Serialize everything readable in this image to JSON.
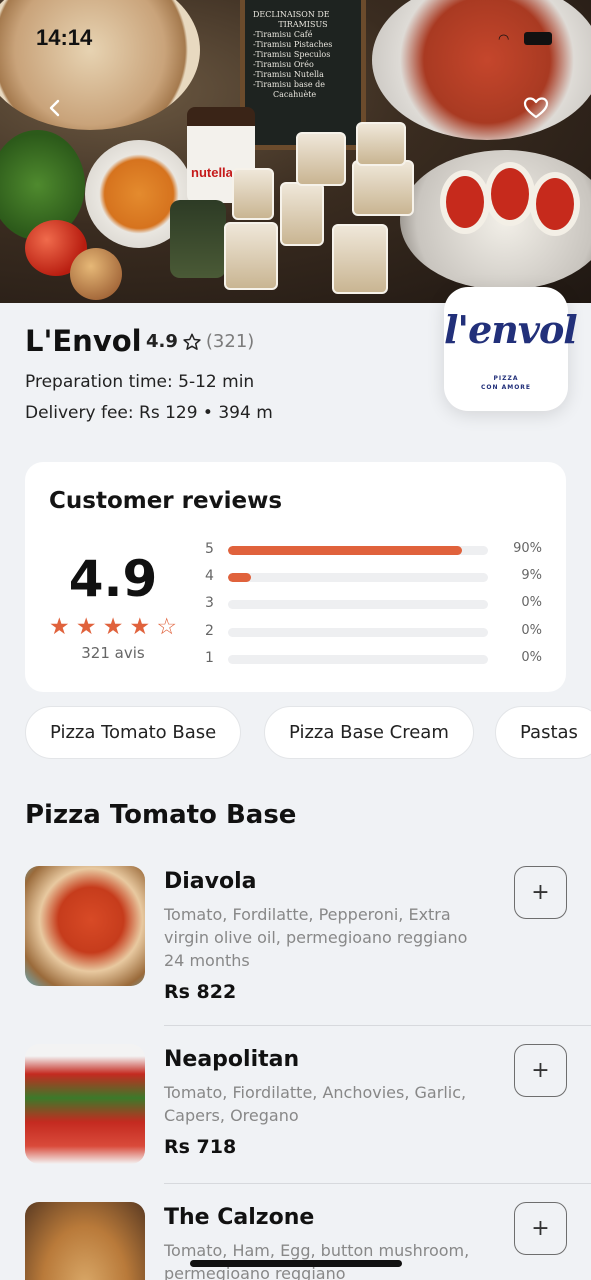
{
  "status_bar": {
    "time": "14:14"
  },
  "hero": {
    "chalkboard_lines": [
      "DECLINAISON DE",
      "TIRAMISUS",
      "-Tiramisu Café",
      "-Tiramisu Pistaches",
      "-Tiramisu Speculos",
      "-Tiramisu Oréo",
      "-Tiramisu Nutella",
      "-Tiramisu base de",
      "Cacahuète"
    ],
    "jar_label": "nutella"
  },
  "restaurant": {
    "name": "L'Envol",
    "rating": "4.9",
    "rating_count": "(321)",
    "prep_time": "Preparation time: 5-12 min",
    "delivery": "Delivery fee: Rs 129 • 394 m",
    "logo": {
      "word": "l'envol",
      "line1": "PIZZA",
      "line2": "CON AMORE"
    }
  },
  "reviews": {
    "title": "Customer reviews",
    "score": "4.9",
    "stars": [
      1,
      1,
      1,
      1,
      0
    ],
    "count_label": "321 avis",
    "distribution": [
      {
        "stars": "5",
        "fraction": 0.9,
        "label": "90%"
      },
      {
        "stars": "4",
        "fraction": 0.09,
        "label": "9%"
      },
      {
        "stars": "3",
        "fraction": 0,
        "label": "0%"
      },
      {
        "stars": "2",
        "fraction": 0,
        "label": "0%"
      },
      {
        "stars": "1",
        "fraction": 0,
        "label": "0%"
      }
    ]
  },
  "categories": [
    "Pizza Tomato Base",
    "Pizza Base Cream",
    "Pastas"
  ],
  "section_title": "Pizza Tomato Base",
  "items": [
    {
      "name": "Diavola",
      "description": "Tomato, Fordilatte, Pepperoni, Extra virgin olive oil, permegioano reggiano 24 months",
      "price": "Rs 822",
      "add_label": "+"
    },
    {
      "name": "Neapolitan",
      "description": "Tomato, Fiordilatte, Anchovies, Garlic, Capers, Oregano",
      "price": "Rs 718",
      "add_label": "+"
    },
    {
      "name": "The Calzone",
      "description": "Tomato, Ham, Egg, button mushroom, permegioano reggiano",
      "price": "",
      "add_label": "+"
    }
  ],
  "colors": {
    "accent": "#e0623c",
    "background": "#f0f2f5",
    "logo_blue": "#22307a"
  }
}
